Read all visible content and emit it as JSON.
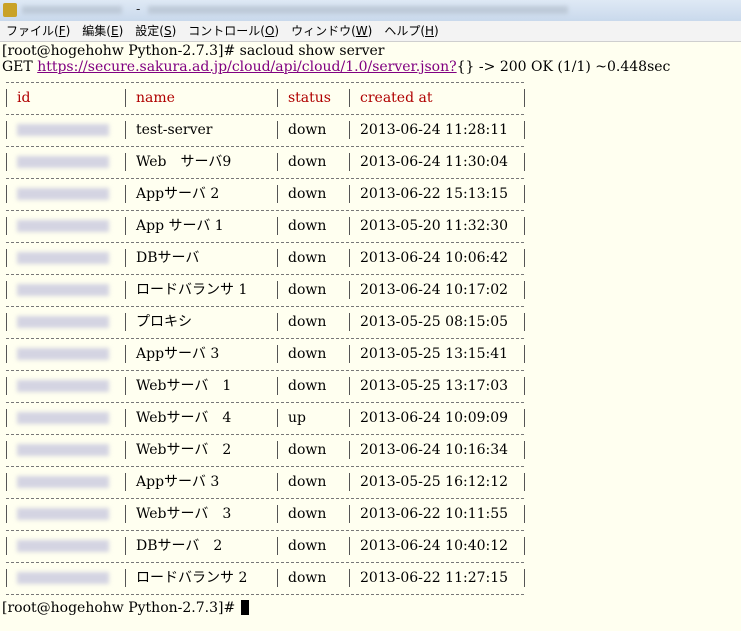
{
  "window": {
    "dash": "-"
  },
  "menu": [
    {
      "label": "ファイル(",
      "acc": "F",
      "end": ")"
    },
    {
      "label": "編集(",
      "acc": "E",
      "end": ")"
    },
    {
      "label": "設定(",
      "acc": "S",
      "end": ")"
    },
    {
      "label": "コントロール(",
      "acc": "O",
      "end": ")"
    },
    {
      "label": "ウィンドウ(",
      "acc": "W",
      "end": ")"
    },
    {
      "label": "ヘルプ(",
      "acc": "H",
      "end": ")"
    }
  ],
  "terminal": {
    "prompt": "[root@hogehohw Python-2.7.3]# ",
    "command": "sacloud show server",
    "get_prefix": "GET ",
    "url": "https://secure.sakura.ad.jp/cloud/api/cloud/1.0/server.json?",
    "get_suffix": "{} -> 200 OK (1/1) ~0.448sec",
    "headers": [
      "id",
      "name",
      "status",
      "created at"
    ],
    "rows": [
      {
        "name": "test-server",
        "status": "down",
        "created": "2013-06-24 11:28:11"
      },
      {
        "name": "Web　サーバ9",
        "status": "down",
        "created": "2013-06-24 11:30:04"
      },
      {
        "name": "Appサーバ 2",
        "status": "down",
        "created": "2013-06-22 15:13:15"
      },
      {
        "name": "App サーバ 1",
        "status": "down",
        "created": "2013-05-20 11:32:30"
      },
      {
        "name": "DBサーバ",
        "status": "down",
        "created": "2013-06-24 10:06:42"
      },
      {
        "name": "ロードバランサ 1",
        "status": "down",
        "created": "2013-06-24 10:17:02"
      },
      {
        "name": "プロキシ",
        "status": "down",
        "created": "2013-05-25 08:15:05"
      },
      {
        "name": "Appサーバ 3",
        "status": "down",
        "created": "2013-05-25 13:15:41"
      },
      {
        "name": "Webサーバ　1",
        "status": "down",
        "created": "2013-05-25 13:17:03"
      },
      {
        "name": "Webサーバ　4",
        "status": "up",
        "created": "2013-06-24 10:09:09"
      },
      {
        "name": "Webサーバ　2",
        "status": "down",
        "created": "2013-06-24 10:16:34"
      },
      {
        "name": "Appサーバ 3",
        "status": "down",
        "created": "2013-05-25 16:12:12"
      },
      {
        "name": "Webサーバ　3",
        "status": "down",
        "created": "2013-06-22 10:11:55"
      },
      {
        "name": "DBサーバ　2",
        "status": "down",
        "created": "2013-06-24 10:40:12"
      },
      {
        "name": "ロードバランサ 2",
        "status": "down",
        "created": "2013-06-22 11:27:15"
      }
    ],
    "final_prompt": "[root@hogehohw Python-2.7.3]# "
  }
}
